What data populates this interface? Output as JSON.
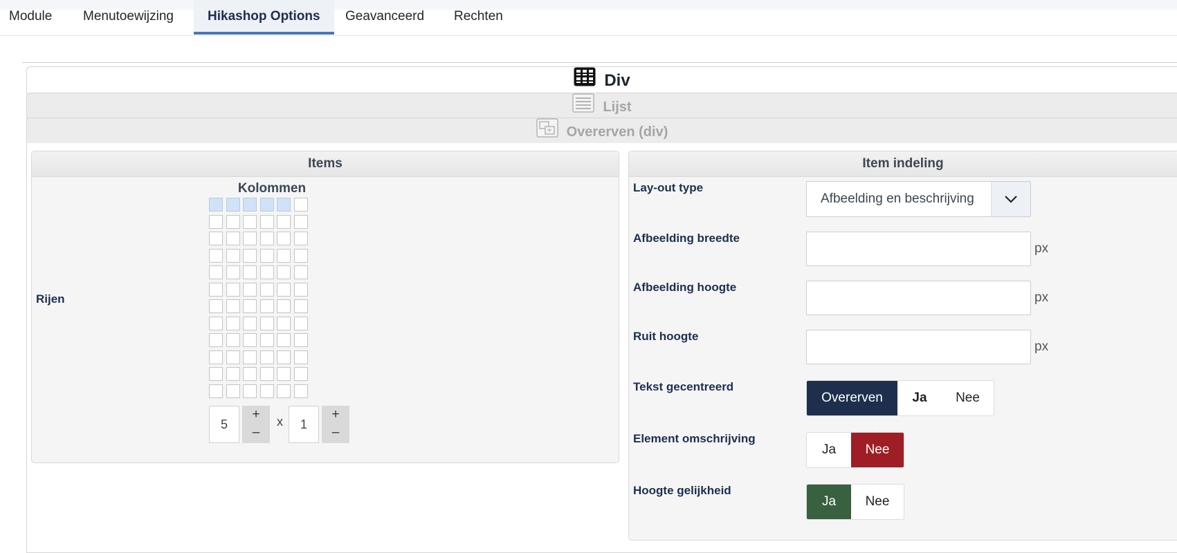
{
  "tabs": [
    {
      "label": "Module",
      "active": false
    },
    {
      "label": "Menutoewijzing",
      "active": false
    },
    {
      "label": "Hikashop Options",
      "active": true
    },
    {
      "label": "Geavanceerd",
      "active": false
    },
    {
      "label": "Rechten",
      "active": false
    }
  ],
  "layout_sections": {
    "div": {
      "label": "Div",
      "icon": "grid-layout-icon"
    },
    "lijst": {
      "label": "Lijst",
      "icon": "list-layout-icon"
    },
    "overerven": {
      "label": "Overerven (div)",
      "icon": "inherit-layout-icon"
    }
  },
  "items_panel": {
    "title": "Items",
    "columns_label": "Kolommen",
    "rows_label": "Rijen",
    "columns_value": "5",
    "rows_value": "1",
    "times": "x",
    "plus": "+",
    "minus": "–",
    "grid_total_columns": 6,
    "grid_total_rows": 12
  },
  "layout_panel": {
    "title": "Item indeling",
    "layout_type": {
      "label": "Lay-out type",
      "value": "Afbeelding en beschrijving"
    },
    "image_width": {
      "label": "Afbeelding breedte",
      "value": "",
      "unit": "px"
    },
    "image_height": {
      "label": "Afbeelding hoogte",
      "value": "",
      "unit": "px"
    },
    "pane_height": {
      "label": "Ruit hoogte",
      "value": "",
      "unit": "px"
    },
    "text_centered": {
      "label": "Tekst gecentreerd",
      "options": [
        "Overerven",
        "Ja",
        "Nee"
      ],
      "selected": "Overerven"
    },
    "element_description": {
      "label": "Element omschrijving",
      "options": [
        "Ja",
        "Nee"
      ],
      "selected": "Nee"
    },
    "equal_height": {
      "label": "Hoogte gelijkheid",
      "options": [
        "Ja",
        "Nee"
      ],
      "selected": "Ja"
    }
  },
  "colors": {
    "active_tab_border": "#4a78b8",
    "inherit_selected": "#1d2f4c",
    "no_selected": "#9f1d24",
    "yes_selected": "#37613f",
    "grid_selected": "#cfe2f7"
  }
}
